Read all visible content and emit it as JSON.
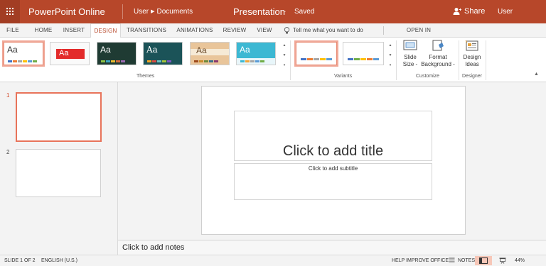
{
  "titlebar": {
    "app_name": "PowerPoint Online",
    "breadcrumb_user": "User",
    "breadcrumb_folder": "Documents",
    "doc_title": "Presentation",
    "separator": "-",
    "save_status": "Saved",
    "share_label": "Share",
    "user_label": "User",
    "color": "#b7472a"
  },
  "tabs": {
    "file": "FILE",
    "home": "HOME",
    "insert": "INSERT",
    "design": "DESIGN",
    "transitions": "TRANSITIONS",
    "animations": "ANIMATIONS",
    "review": "REVIEW",
    "view": "VIEW",
    "tell_me": "Tell me what you want to do",
    "open_in_app": "OPEN IN POWERPOINT",
    "active": "DESIGN"
  },
  "ribbon": {
    "themes_label": "Themes",
    "themes": [
      {
        "name": "office-theme",
        "sample": "Aa"
      },
      {
        "name": "red-theme",
        "sample": "Aa"
      },
      {
        "name": "dark-green-theme",
        "sample": "Aa"
      },
      {
        "name": "teal-theme",
        "sample": "Aa"
      },
      {
        "name": "tan-theme",
        "sample": "Aa"
      },
      {
        "name": "cyan-theme",
        "sample": "Aa"
      }
    ],
    "variants_label": "Variants",
    "slide_size_label": "Slide",
    "slide_size_label2": "Size -",
    "format_bg_label": "Format",
    "format_bg_label2": "Background -",
    "customize_label": "Customize",
    "design_ideas_label": "Design",
    "design_ideas_label2": "Ideas",
    "designer_label": "Designer"
  },
  "thumbnails": [
    {
      "number": "1",
      "selected": true
    },
    {
      "number": "2",
      "selected": false
    }
  ],
  "slide": {
    "title_placeholder": "Click to add title",
    "subtitle_placeholder": "Click to add subtitle"
  },
  "notes": {
    "placeholder": "Click to add notes"
  },
  "statusbar": {
    "slide_count": "SLIDE 1 OF 2",
    "language": "ENGLISH (U.S.)",
    "help_improve": "HELP IMPROVE OFFICE",
    "notes_label": "NOTES",
    "zoom": "44%"
  }
}
